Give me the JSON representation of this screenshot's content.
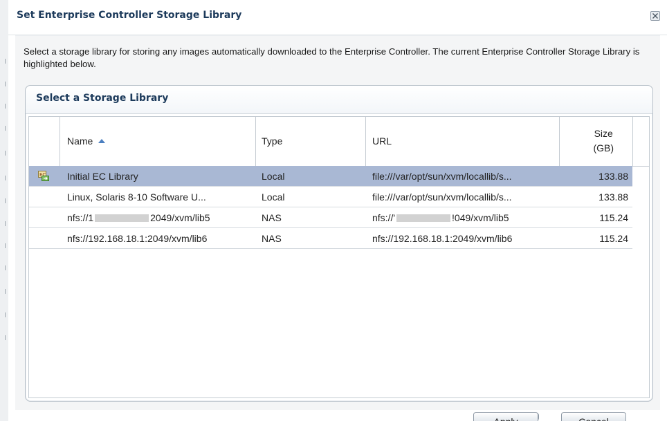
{
  "dialog": {
    "title": "Set Enterprise Controller Storage Library",
    "close_icon": "close-icon",
    "description": "Select a storage library for storing any images automatically downloaded to the Enterprise Controller. The current Enterprise Controller Storage Library is highlighted below."
  },
  "panel": {
    "title": "Select a Storage Library"
  },
  "table": {
    "columns": {
      "name": "Name",
      "type": "Type",
      "url": "URL",
      "size_line1": "Size",
      "size_line2": "(GB)"
    },
    "sort_icon": "sort-ascending-icon",
    "rows": [
      {
        "name": "Initial EC Library",
        "type": "Local",
        "url": "file:///var/opt/sun/xvm/locallib/s...",
        "size": "133.88",
        "selected": true,
        "icon": "ec-library-icon"
      },
      {
        "name": "Linux, Solaris 8-10 Software U...",
        "type": "Local",
        "url": "file:///var/opt/sun/xvm/locallib/s...",
        "size": "133.88",
        "selected": false
      },
      {
        "name_pre": "nfs://1",
        "name_post": "2049/xvm/lib5",
        "type": "NAS",
        "url_pre": "nfs://'",
        "url_post": "!049/xvm/lib5",
        "size": "115.24",
        "selected": false
      },
      {
        "name": "nfs://192.168.18.1:2049/xvm/lib6",
        "type": "NAS",
        "url": "nfs://192.168.18.1:2049/xvm/lib6",
        "size": "115.24",
        "selected": false
      }
    ]
  },
  "buttons": {
    "apply": "Apply",
    "cancel": "Cancel"
  }
}
